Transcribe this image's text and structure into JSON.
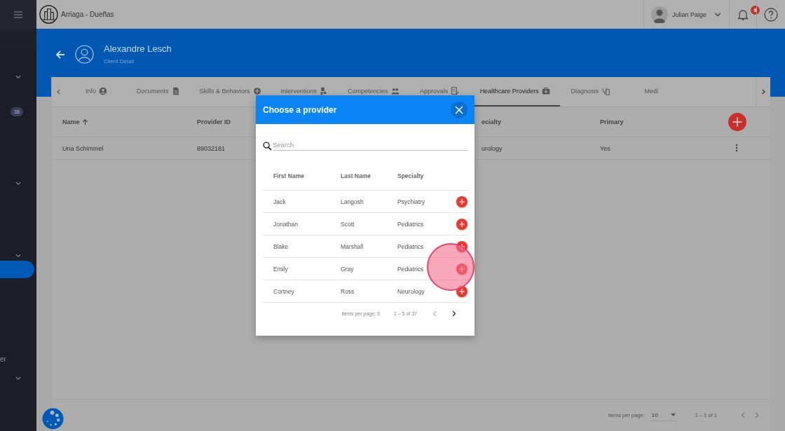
{
  "app": {
    "title": "Arriaga - Dueñas"
  },
  "user": {
    "name": "Julian Paige"
  },
  "notifications": {
    "count": "9"
  },
  "sidebar": {
    "items": [
      {
        "kind": "chevron"
      },
      {
        "kind": "badge",
        "text": "38"
      },
      {
        "kind": "chevron"
      },
      {
        "kind": "chevron"
      },
      {
        "kind": "nav",
        "selected": true
      },
      {
        "kind": "label",
        "text": "er"
      },
      {
        "kind": "chevron"
      }
    ]
  },
  "client": {
    "name": "Alexandre Lesch",
    "subtitle": "Client Detail"
  },
  "tabs": [
    {
      "label": "Info",
      "selected": false
    },
    {
      "label": "Documents",
      "selected": false
    },
    {
      "label": "Skills & Behaviors",
      "selected": false
    },
    {
      "label": "Interventions",
      "selected": false
    },
    {
      "label": "Competencies",
      "selected": false
    },
    {
      "label": "Approvals",
      "selected": false
    },
    {
      "label": "Healthcare Providers",
      "selected": true
    },
    {
      "label": "Diagnosis",
      "selected": false
    },
    {
      "label": "Medi",
      "selected": false
    }
  ],
  "table": {
    "columns": [
      {
        "label": "Name",
        "sorted": true
      },
      {
        "label": "Provider ID",
        "sorted": false
      },
      {
        "label": "ecialty",
        "sorted": false
      },
      {
        "label": "Primary",
        "sorted": false
      }
    ],
    "rows": [
      [
        "Una Schimmel",
        "89032181",
        "urology",
        "Yes"
      ]
    ]
  },
  "paginator": {
    "label": "Items per page:",
    "page_size": "10",
    "range": "1 – 1 of 1",
    "previous": {
      "disabled": true
    },
    "next": {
      "disabled": true
    }
  },
  "dialog": {
    "title": "Choose a provider",
    "search": {
      "placeholder": "Search"
    },
    "columns": [
      "First Name",
      "Last Name",
      "Specialty"
    ],
    "rows": [
      [
        "Jack",
        "Langosh",
        "Psychiatry"
      ],
      [
        "Jonathan",
        "Scott",
        "Pediatrics"
      ],
      [
        "Blake",
        "Marshall",
        "Pediatrics"
      ],
      [
        "Emily",
        "Gray",
        "Pediatrics"
      ],
      [
        "Cortney",
        "Ross",
        "Neurology"
      ]
    ],
    "paginator": {
      "label": "Items per page: 5",
      "range": "1 – 5 of 37",
      "previous": {
        "disabled": true
      },
      "next": {
        "disabled": false
      }
    }
  }
}
